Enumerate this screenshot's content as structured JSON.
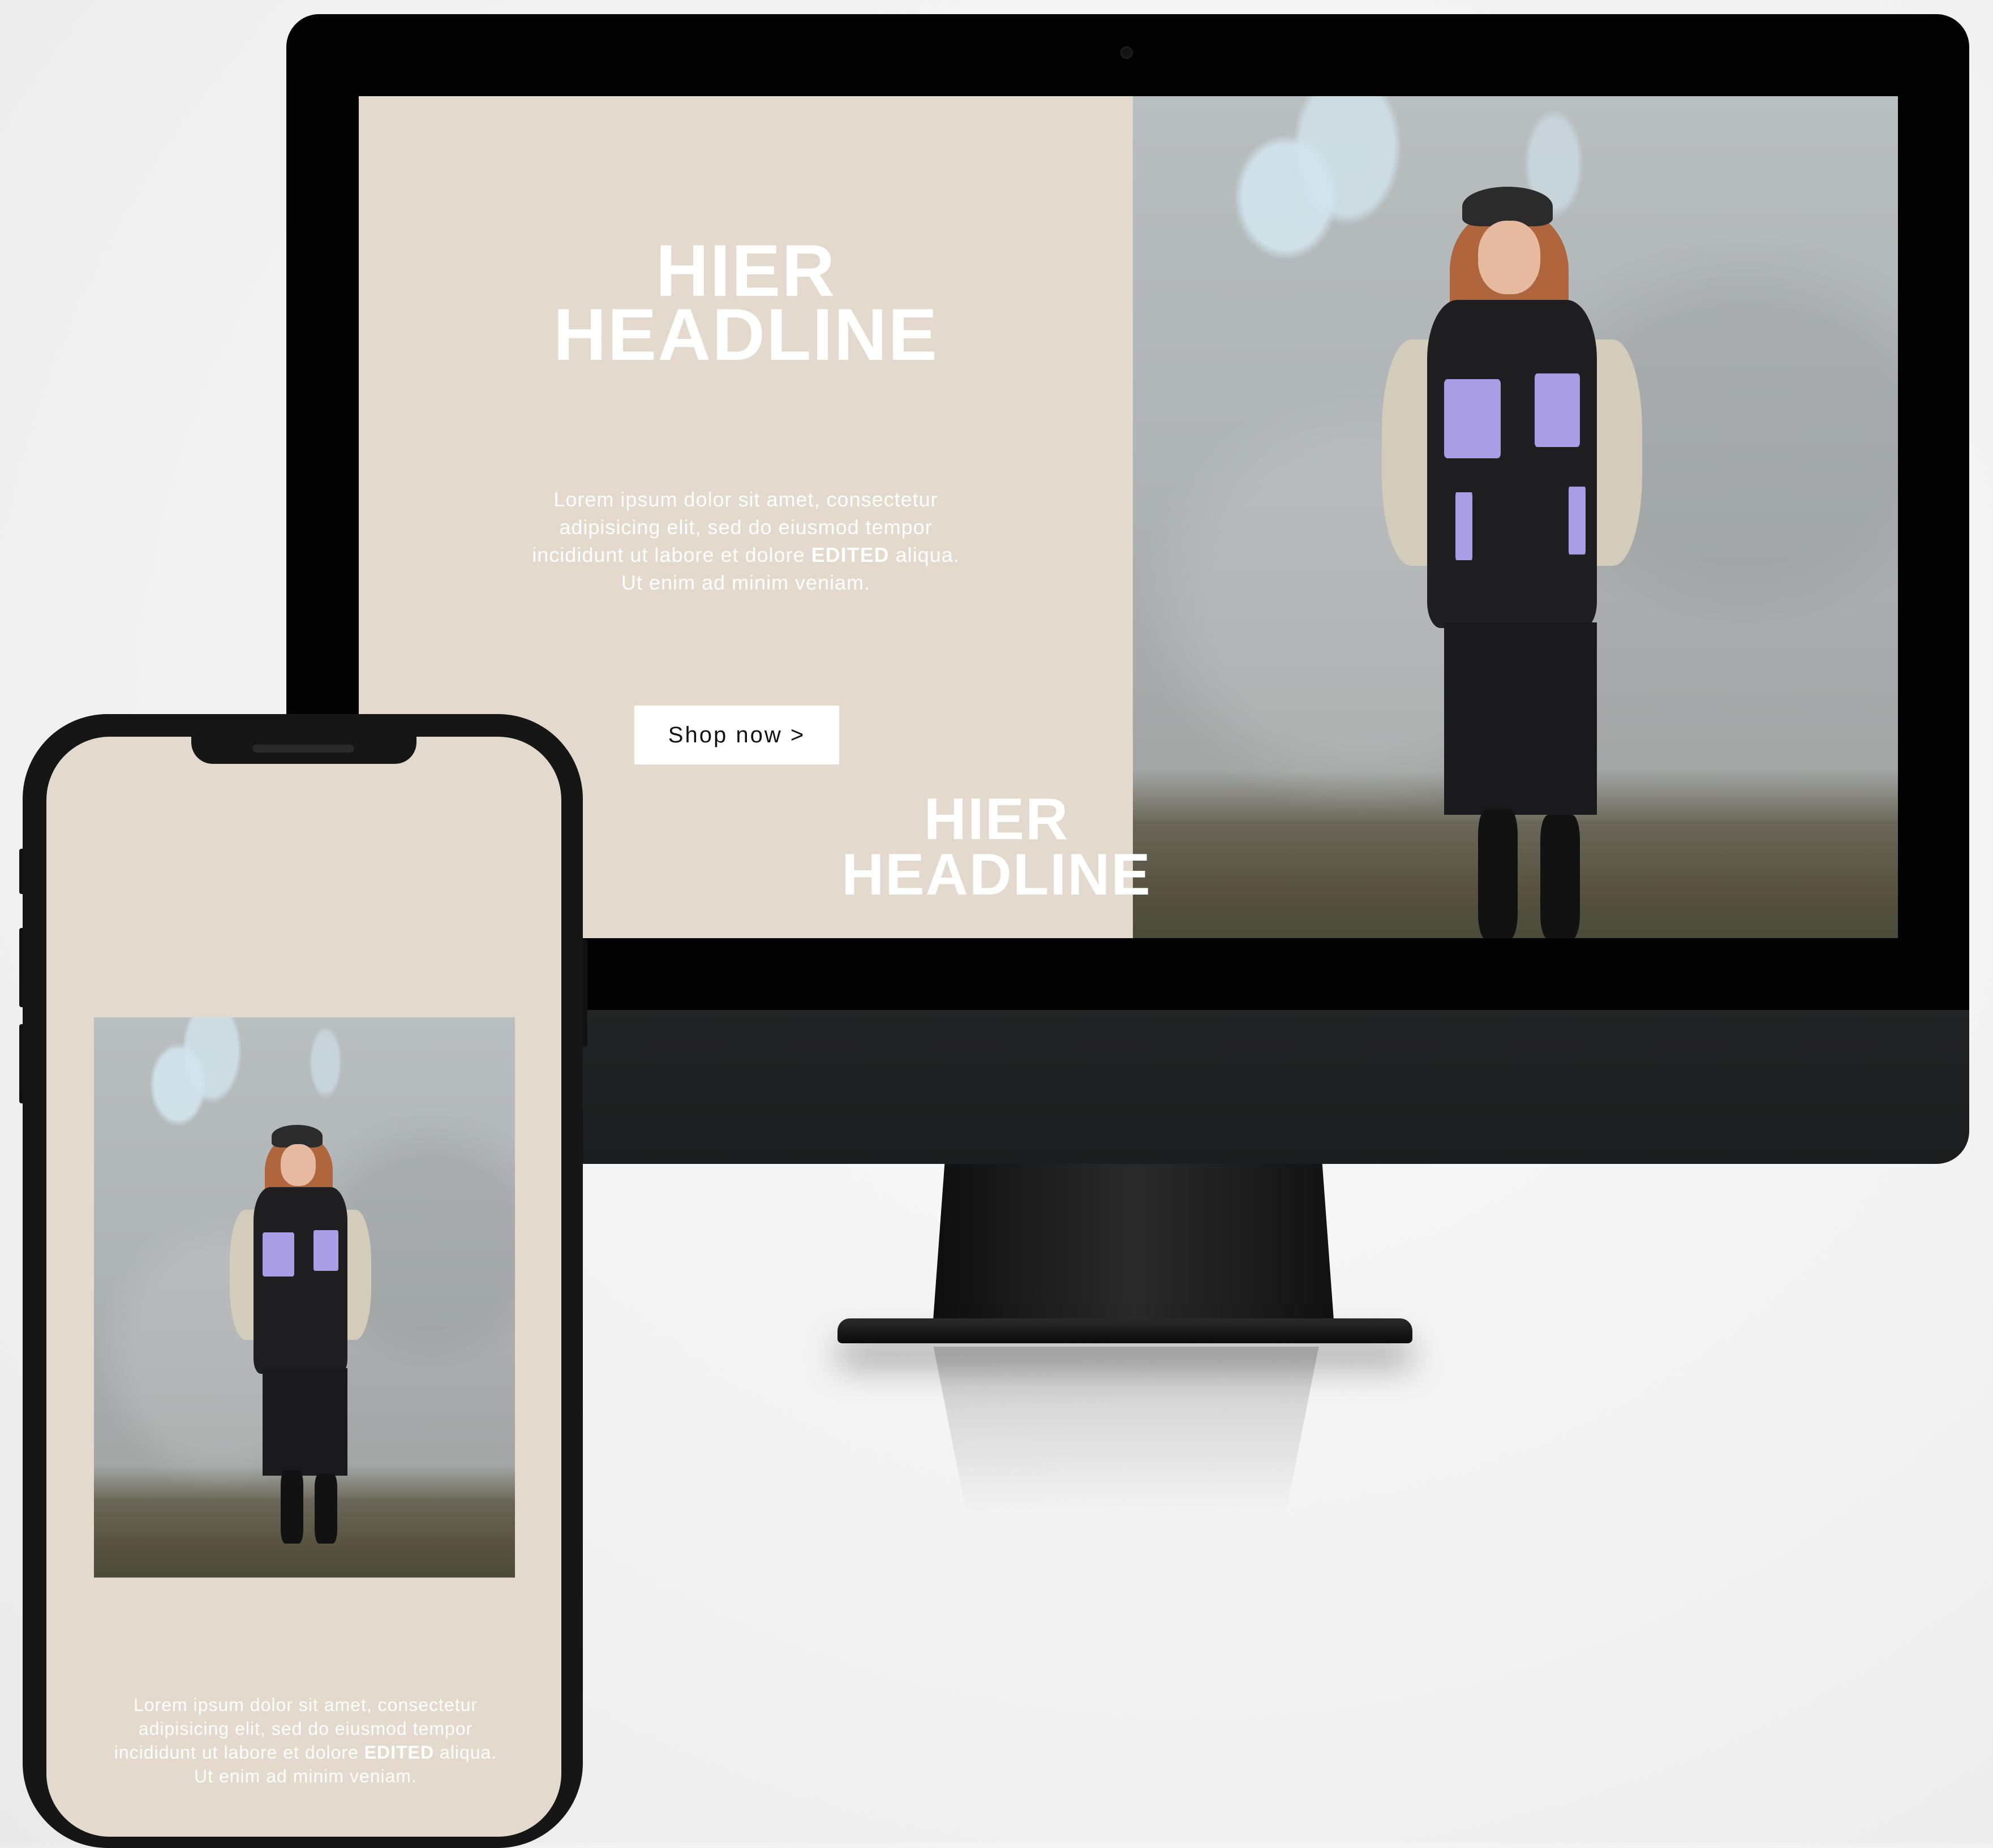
{
  "desktop": {
    "headline_line1": "HIER",
    "headline_line2": "HEADLINE",
    "body_before": "Lorem ipsum dolor sit amet, consectetur adipisicing elit, sed do eiusmod tempor incididunt ut labore et dolore ",
    "body_bold": "EDITED",
    "body_after": " aliqua. Ut enim ad minim veniam.",
    "cta_label": "Shop now >",
    "photo_icon": "fashion-model-photo"
  },
  "mobile": {
    "headline_line1": "HIER",
    "headline_line2": "HEADLINE",
    "body_before": "Lorem ipsum dolor sit amet, consectetur adipisicing elit, sed do eiusmod tempor incididunt ut labore et dolore ",
    "body_bold": "EDITED",
    "body_after": " aliqua. Ut enim ad minim veniam.",
    "photo_icon": "fashion-model-photo"
  },
  "colors": {
    "panel_beige": "#e4d9cd",
    "text_white": "#ffffff",
    "button_bg": "#ffffff",
    "button_text": "#111111",
    "device_black": "#020202",
    "pocket_lilac": "#a99de6"
  }
}
